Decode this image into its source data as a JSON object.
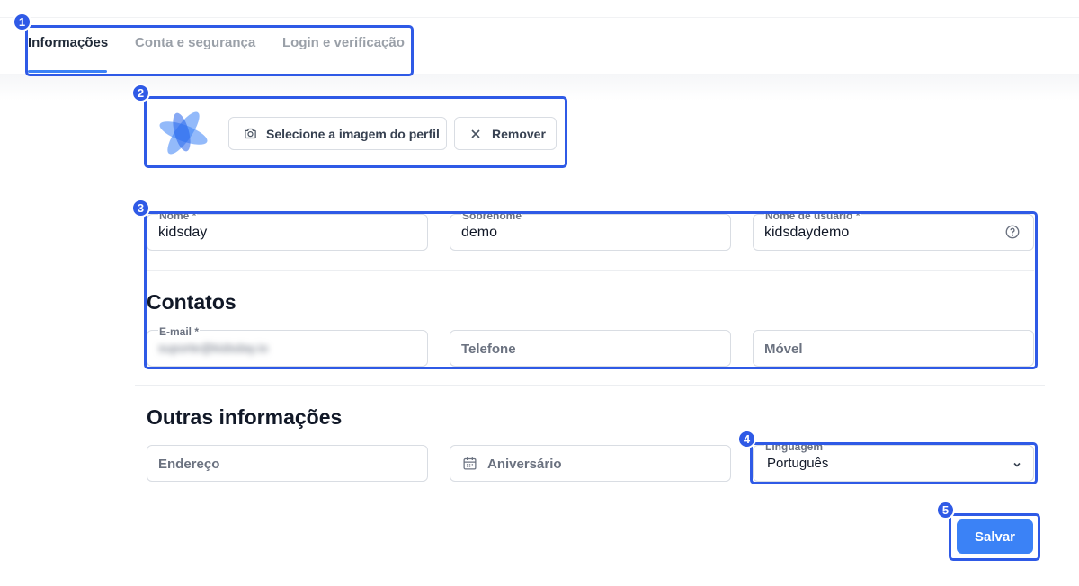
{
  "tabs": [
    {
      "label": "Informações",
      "active": true
    },
    {
      "label": "Conta e segurança",
      "active": false
    },
    {
      "label": "Login e verificação",
      "active": false
    }
  ],
  "avatar": {
    "select_label": "Selecione a imagem do perfil",
    "remove_label": "Remover",
    "select_icon": "camera-icon",
    "remove_icon": "close-icon"
  },
  "profile": {
    "first_name": {
      "label": "Nome *",
      "value": "kidsday"
    },
    "last_name": {
      "label": "Sobrenome",
      "value": "demo"
    },
    "username": {
      "label": "Nome de usuário *",
      "value": "kidsdaydemo",
      "icon": "help-icon"
    }
  },
  "contacts": {
    "title": "Contatos",
    "email": {
      "label": "E-mail *",
      "value": "suporte@kidsday.io"
    },
    "phone": {
      "placeholder": "Telefone"
    },
    "mobile": {
      "placeholder": "Móvel"
    }
  },
  "other": {
    "title": "Outras informações",
    "address": {
      "placeholder": "Endereço"
    },
    "birthday": {
      "placeholder": "Aniversário",
      "icon": "calendar-icon"
    },
    "language": {
      "label": "Linguagem",
      "value": "Português",
      "icon": "chevron-down-icon"
    }
  },
  "actions": {
    "save_label": "Salvar"
  },
  "annotations": [
    "1",
    "2",
    "3",
    "4",
    "5"
  ],
  "colors": {
    "accent": "#3b82f6",
    "annotation": "#2f5ae6",
    "text": "#111827",
    "muted": "#6b7280",
    "border": "#d9dde3"
  }
}
